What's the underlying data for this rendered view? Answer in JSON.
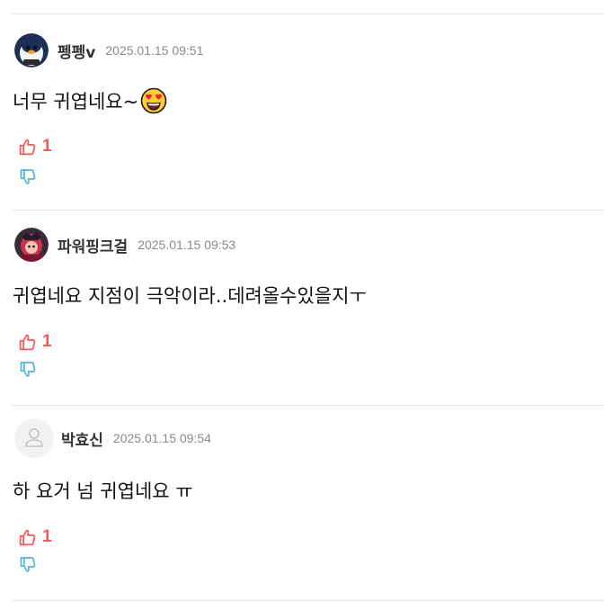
{
  "comments": [
    {
      "author": "펭펭v",
      "date": "2025.01.15 09:51",
      "text": "너무 귀엽네요~",
      "emoji": "heart-eyes-emoji",
      "likes": "1",
      "avatar": "penguin-avatar"
    },
    {
      "author": "파워핑크걸",
      "date": "2025.01.15 09:53",
      "text": "귀엽네요 지점이 극악이라..데려올수있을지ㅜ",
      "likes": "1",
      "avatar": "character-avatar"
    },
    {
      "author": "박효신",
      "date": "2025.01.15 09:54",
      "text": "하 요거 넘 귀엽네요 ㅠ",
      "likes": "1",
      "avatar": "default-user-avatar"
    }
  ],
  "colors": {
    "like": "#f15b5b",
    "dislike": "#4fb3d9",
    "divider": "#e6e6e6",
    "date": "#8a8a8a"
  }
}
